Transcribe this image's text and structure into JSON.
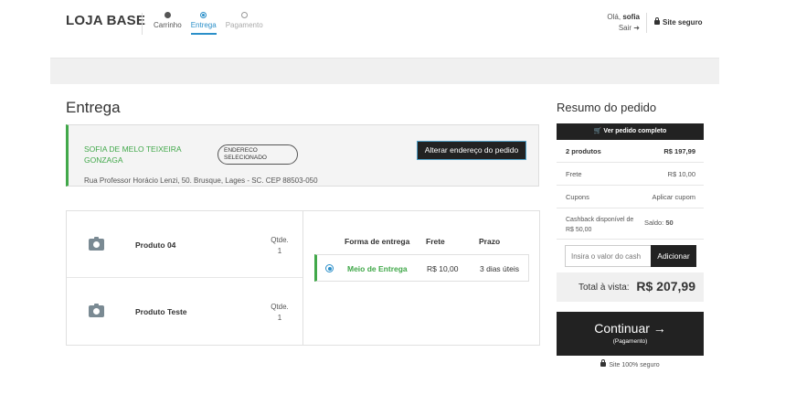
{
  "header": {
    "logo": "LOJA BASE",
    "steps": [
      {
        "label": "Carrinho",
        "state": "done"
      },
      {
        "label": "Entrega",
        "state": "active"
      },
      {
        "label": "Pagamento",
        "state": "pending"
      }
    ],
    "greeting": "Olá,",
    "user_name": "sofia",
    "logout": "Sair ➜",
    "secure": "Site seguro"
  },
  "delivery": {
    "title": "Entrega",
    "recipient": "SOFIA DE MELO TEIXEIRA GONZAGA",
    "badge": "ENDERECO SELECIONADO",
    "change_button": "Alterar endereço do pedido",
    "address": "Rua Professor Horácio Lenzi, 50. Brusque, Lages - SC. CEP 88503-050"
  },
  "products": [
    {
      "name": "Produto 04",
      "qty_label": "Qtde.",
      "qty": "1"
    },
    {
      "name": "Produto Teste",
      "qty_label": "Qtde.",
      "qty": "1"
    }
  ],
  "shipping": {
    "headers": {
      "method": "Forma de entrega",
      "price": "Frete",
      "term": "Prazo"
    },
    "option": {
      "name": "Meio de Entrega",
      "price": "R$ 10,00",
      "term": "3 dias úteis"
    }
  },
  "summary": {
    "title": "Resumo do pedido",
    "view_full": "Ver pedido completo",
    "products_label": "2 produtos",
    "products_value": "R$ 197,99",
    "shipping_label": "Frete",
    "shipping_value": "R$ 10,00",
    "coupons_label": "Cupons",
    "coupons_action": "Aplicar cupom",
    "cashback_label": "Cashback disponível de R$ 50,00",
    "balance_label": "Saldo:",
    "balance_value": "50",
    "cash_placeholder": "Insira o valor do cash",
    "cash_button": "Adicionar",
    "total_label": "Total à vista:",
    "total_value": "R$ 207,99",
    "continue_label": "Continuar →",
    "continue_sub": "(Pagamento)",
    "secure_footer": "Site 100% seguro"
  }
}
